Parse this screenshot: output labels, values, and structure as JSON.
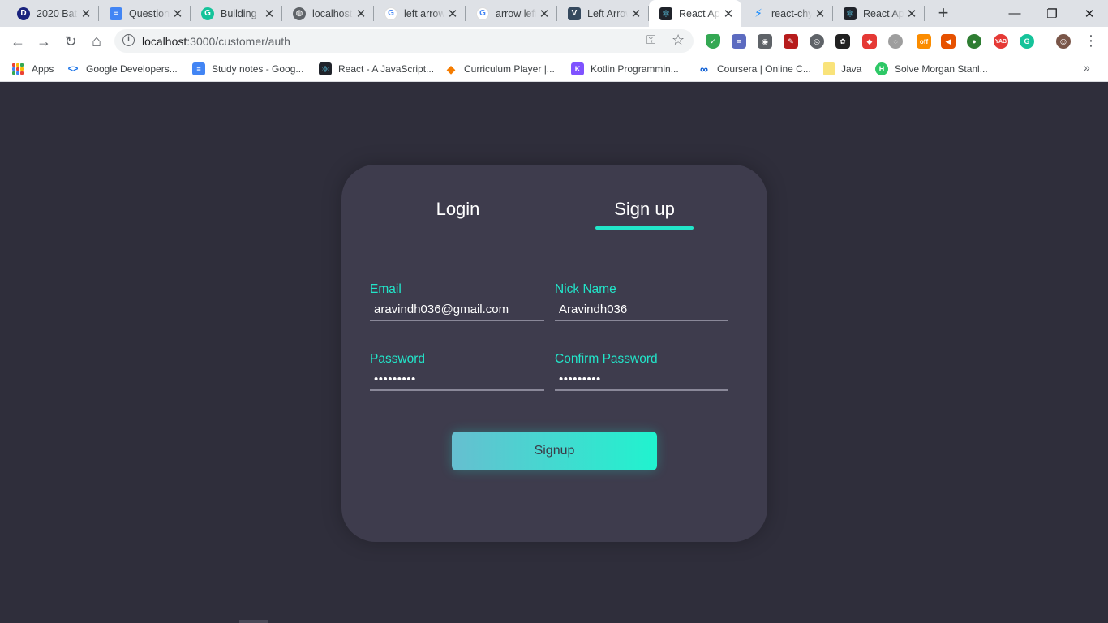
{
  "browser": {
    "tabs": [
      {
        "title": "2020 Batch",
        "icon": "d-logo-icon",
        "color": "#1a237e",
        "glyph": "D"
      },
      {
        "title": "Question",
        "icon": "docs-icon",
        "color": "#4285f4",
        "glyph": "≡"
      },
      {
        "title": "Building",
        "icon": "grammarly-icon",
        "color": "#15c39a",
        "glyph": "G"
      },
      {
        "title": "localhost",
        "icon": "globe-icon",
        "color": "#5f6368",
        "glyph": "◍"
      },
      {
        "title": "left arrow",
        "icon": "google-icon",
        "color": "#4285f4",
        "glyph": "G"
      },
      {
        "title": "arrow left",
        "icon": "google-icon",
        "color": "#4285f4",
        "glyph": "G"
      },
      {
        "title": "Left Arrow",
        "icon": "vue-icon",
        "color": "#35495e",
        "glyph": "V"
      },
      {
        "title": "React App",
        "icon": "react-icon",
        "color": "#20232a",
        "glyph": "⚛",
        "active": true
      },
      {
        "title": "react-chy",
        "icon": "bolt-icon",
        "color": "#1389fd",
        "glyph": "⚡"
      },
      {
        "title": "React App",
        "icon": "react-icon",
        "color": "#20232a",
        "glyph": "⚛"
      }
    ],
    "new_tab": "+",
    "close_glyph": "✕",
    "window_controls": {
      "minimize": "—",
      "maximize": "❐",
      "close": "✕"
    },
    "nav": {
      "back": "←",
      "forward": "→",
      "reload": "↻",
      "home": "⌂"
    },
    "url_host": "localhost",
    "url_path": ":3000/customer/auth",
    "info_glyph": "i",
    "key_glyph": "⚿",
    "star_glyph": "☆",
    "menu_glyph": "⋮",
    "extensions": [
      {
        "icon": "shield-ext-icon",
        "color": "#34a853",
        "glyph": "✓"
      },
      {
        "icon": "stack-ext-icon",
        "color": "#5c6bc0",
        "glyph": "≡"
      },
      {
        "icon": "camera-ext-icon",
        "color": "#5f6368",
        "glyph": "◉"
      },
      {
        "icon": "eyedropper-ext-icon",
        "color": "#b71c1c",
        "glyph": "✎"
      },
      {
        "icon": "circle-ext-icon",
        "color": "#5f6368",
        "glyph": "◎"
      },
      {
        "icon": "paw-ext-icon",
        "color": "#212121",
        "glyph": "✿"
      },
      {
        "icon": "puzzle-ext-icon",
        "color": "#e53935",
        "glyph": "◆"
      },
      {
        "icon": "compass-ext-icon",
        "color": "#9e9e9e",
        "glyph": "◌"
      },
      {
        "icon": "off-badge-ext-icon",
        "color": "#fb8c00",
        "glyph": "off"
      },
      {
        "icon": "megaphone-ext-icon",
        "color": "#e65100",
        "glyph": "◀"
      },
      {
        "icon": "globe-warning-ext-icon",
        "color": "#2e7d32",
        "glyph": "●"
      },
      {
        "icon": "yab-ext-icon",
        "color": "#e53935",
        "glyph": "YAB"
      },
      {
        "icon": "grammarly-ext-icon",
        "color": "#15c39a",
        "glyph": "G"
      },
      {
        "icon": "profile-avatar-icon",
        "color": "#795548",
        "glyph": "☺"
      }
    ],
    "bookmarks": [
      {
        "label": "Apps",
        "icon": "apps-grid-icon"
      },
      {
        "label": "Google Developers...",
        "icon": "google-dev-icon",
        "color": "#1a73e8",
        "glyph": "<>"
      },
      {
        "label": "Study notes - Goog...",
        "icon": "docs-icon",
        "color": "#4285f4",
        "glyph": "≡"
      },
      {
        "label": "React - A JavaScript...",
        "icon": "react-icon",
        "color": "#20232a",
        "glyph": "⚛"
      },
      {
        "label": "Curriculum Player |...",
        "icon": "cube-icon",
        "color": "#f57c00",
        "glyph": "◆"
      },
      {
        "label": "Kotlin Programmin...",
        "icon": "kotlin-icon",
        "color": "#7f52ff",
        "glyph": "K"
      },
      {
        "label": "Coursera | Online C...",
        "icon": "coursera-icon",
        "color": "#0056d2",
        "glyph": "∞"
      },
      {
        "label": "Java",
        "icon": "folder-icon",
        "color": "#f9e37a",
        "glyph": ""
      },
      {
        "label": "Solve Morgan Stanl...",
        "icon": "hackerrank-icon",
        "color": "#2ec866",
        "glyph": "H"
      }
    ],
    "bookmarks_more": "»"
  },
  "auth": {
    "tabs": {
      "login": "Login",
      "signup": "Sign up"
    },
    "active_tab": "signup",
    "fields": {
      "email": {
        "label": "Email",
        "value": "aravindh036@gmail.com"
      },
      "nickname": {
        "label": "Nick Name",
        "value": "Aravindh036"
      },
      "password": {
        "label": "Password",
        "value": "•••••••••"
      },
      "confirm_password": {
        "label": "Confirm Password",
        "value": "•••••••••"
      }
    },
    "submit_label": "Signup",
    "accent_color": "#22e5c9"
  }
}
